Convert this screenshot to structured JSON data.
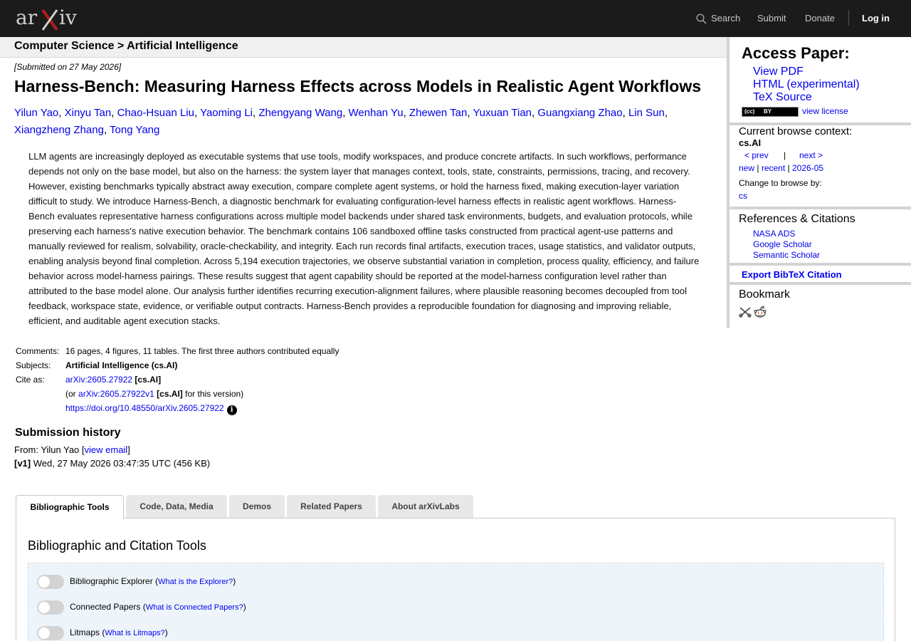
{
  "nav": {
    "search": "Search",
    "submit": "Submit",
    "donate": "Donate",
    "login": "Log in"
  },
  "breadcrumb": "Computer Science > Artificial Intelligence",
  "paper": {
    "submitted": "[Submitted on 27 May 2026]",
    "title": "Harness-Bench: Measuring Harness Effects across Models in Realistic Agent Workflows",
    "authors": [
      "Yilun Yao",
      "Xinyu Tan",
      "Chao-Hsuan Liu",
      "Yaoming Li",
      "Zhengyang Wang",
      "Wenhan Yu",
      "Zhewen Tan",
      "Yuxuan Tian",
      "Guangxiang Zhao",
      "Lin Sun",
      "Xiangzheng Zhang",
      "Tong Yang"
    ],
    "abstract": "LLM agents are increasingly deployed as executable systems that use tools, modify workspaces, and produce concrete artifacts. In such workflows, performance depends not only on the base model, but also on the harness: the system layer that manages context, tools, state, constraints, permissions, tracing, and recovery. However, existing benchmarks typically abstract away execution, compare complete agent systems, or hold the harness fixed, making execution-layer variation difficult to study. We introduce Harness-Bench, a diagnostic benchmark for evaluating configuration-level harness effects in realistic agent workflows. Harness-Bench evaluates representative harness configurations across multiple model backends under shared task environments, budgets, and evaluation protocols, while preserving each harness's native execution behavior. The benchmark contains 106 sandboxed offline tasks constructed from practical agent-use patterns and manually reviewed for realism, solvability, oracle-checkability, and integrity. Each run records final artifacts, execution traces, usage statistics, and validator outputs, enabling analysis beyond final completion. Across 5,194 execution trajectories, we observe substantial variation in completion, process quality, efficiency, and failure behavior across model-harness pairings. These results suggest that agent capability should be reported at the model-harness configuration level rather than attributed to the base model alone. Our analysis further identifies recurring execution-alignment failures, where plausible reasoning becomes decoupled from tool feedback, workspace state, evidence, or verifiable output contracts. Harness-Bench provides a reproducible foundation for diagnosing and improving reliable, efficient, and auditable agent execution stacks."
  },
  "meta": {
    "comments_label": "Comments:",
    "comments": "16 pages, 4 figures, 11 tables. The first three authors contributed equally",
    "subjects_label": "Subjects:",
    "subjects": "Artificial Intelligence (cs.AI)",
    "cite_label": "Cite as:",
    "cite_id": "arXiv:2605.27922",
    "cite_cat": "[cs.AI]",
    "or_prefix": "(or",
    "cite_version": "arXiv:2605.27922v1",
    "version_suffix": "for this version)",
    "doi": "https://doi.org/10.48550/arXiv.2605.27922",
    "info_glyph": "i"
  },
  "history": {
    "title": "Submission history",
    "from_prefix": "From: Yilun Yao [",
    "view_email": "view email",
    "from_suffix": "]",
    "v1_label": "[v1]",
    "v1_text": "Wed, 27 May 2026 03:47:35 UTC (456 KB)"
  },
  "tabs": [
    {
      "label": "Bibliographic Tools",
      "active": true
    },
    {
      "label": "Code, Data, Media"
    },
    {
      "label": "Demos"
    },
    {
      "label": "Related Papers"
    },
    {
      "label": "About arXivLabs"
    }
  ],
  "panel": {
    "title": "Bibliographic and Citation Tools",
    "tools": [
      {
        "label": "Bibliographic Explorer",
        "help": "What is the Explorer?"
      },
      {
        "label": "Connected Papers",
        "help": "What is Connected Papers?"
      },
      {
        "label": "Litmaps",
        "help": "What is Litmaps?"
      }
    ]
  },
  "sidebar": {
    "access_title": "Access Paper:",
    "view_pdf": "View PDF",
    "html": "HTML (experimental)",
    "tex": "TeX Source",
    "cc_left": "(cc)",
    "cc_right": "BY",
    "view_license": "view license",
    "context_title": "Current browse context:",
    "context_cat": "cs.AI",
    "prev": "< prev",
    "bar": "|",
    "next": "next >",
    "new": "new",
    "recent": "recent",
    "month": "2026-05",
    "sep": "|",
    "change_browse": "Change to browse by:",
    "cs": "cs",
    "refs_title": "References & Citations",
    "nasa": "NASA ADS",
    "google": "Google Scholar",
    "semantic": "Semantic Scholar",
    "export_bib": "Export BibTeX Citation",
    "bookmark_title": "Bookmark"
  },
  "colors": {
    "topbar": "#1b1b1b",
    "logo_x": "#b31b1b",
    "link": "#0000ee"
  }
}
